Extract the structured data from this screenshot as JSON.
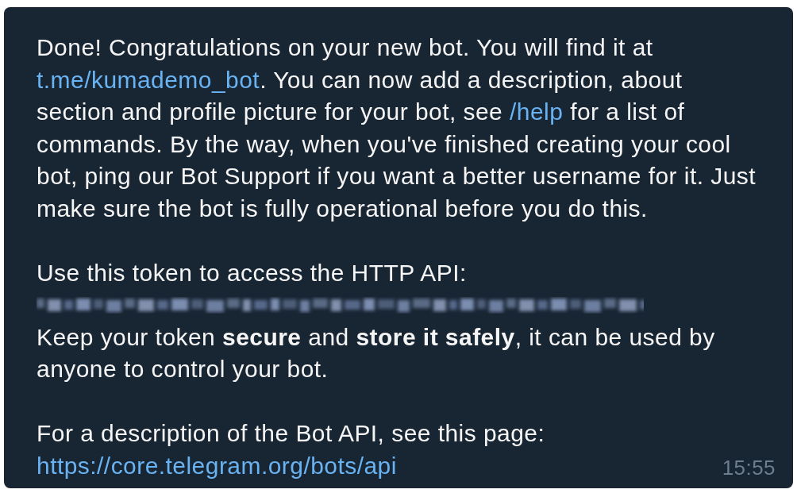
{
  "message": {
    "paragraphs": [
      {
        "lines": [
          [
            {
              "kind": "text",
              "text": "Done! Congratulations on your new bot. You will find it at"
            }
          ],
          [
            {
              "kind": "link",
              "text": "t.me/kumademo_bot"
            },
            {
              "kind": "text",
              "text": ". You can now add a description, about"
            }
          ],
          [
            {
              "kind": "text",
              "text": "section and profile picture for your bot, see "
            },
            {
              "kind": "link",
              "text": "/help"
            },
            {
              "kind": "text",
              "text": " for a list of"
            }
          ],
          [
            {
              "kind": "text",
              "text": "commands. By the way, when you've finished creating your cool"
            }
          ],
          [
            {
              "kind": "text",
              "text": "bot, ping our Bot Support if you want a better username for it. Just"
            }
          ],
          [
            {
              "kind": "text",
              "text": "make sure the bot is fully operational before you do this."
            }
          ]
        ]
      },
      {
        "lines": [
          [
            {
              "kind": "text",
              "text": "Use this token to access the HTTP API:"
            }
          ],
          [
            {
              "kind": "redacted"
            }
          ],
          [
            {
              "kind": "text",
              "text": "Keep your token **secure** and **store it safely**, it can be used by"
            }
          ],
          [
            {
              "kind": "text",
              "text": "anyone to control your bot."
            }
          ]
        ]
      },
      {
        "lines": [
          [
            {
              "kind": "text",
              "text": "For a description of the Bot API, see this page:"
            }
          ],
          [
            {
              "kind": "link",
              "text": "https://core.telegram.org/bots/api"
            }
          ]
        ]
      }
    ],
    "time": "15:55"
  }
}
